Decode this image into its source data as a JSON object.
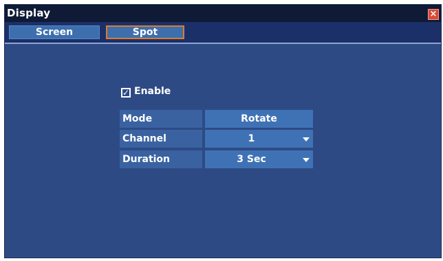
{
  "window": {
    "title": "Display",
    "close_icon": "close-icon",
    "close_glyph": "×"
  },
  "tabs": [
    {
      "label": "Screen",
      "selected": false
    },
    {
      "label": "Spot",
      "selected": true
    }
  ],
  "spot": {
    "enable": {
      "label": "Enable",
      "checked": true,
      "check_glyph": "✓"
    },
    "rows": [
      {
        "label": "Mode",
        "value": "Rotate",
        "dropdown": false
      },
      {
        "label": "Channel",
        "value": "1",
        "dropdown": true
      },
      {
        "label": "Duration",
        "value": "3 Sec",
        "dropdown": true
      }
    ]
  },
  "colors": {
    "background": "#2e4a85",
    "titlebar": "#0e1a36",
    "tab_focus_border": "#e07b2a",
    "close_button": "#d84a36"
  }
}
